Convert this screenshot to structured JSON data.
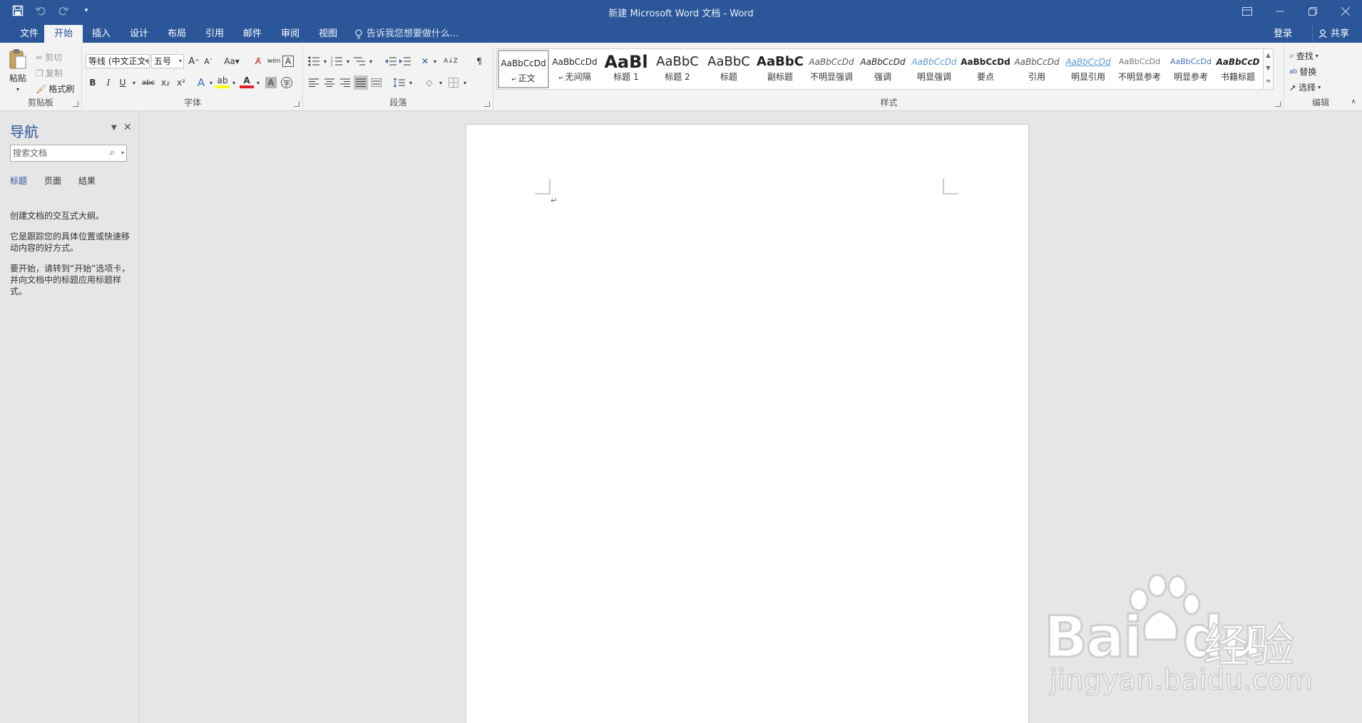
{
  "window": {
    "title": "新建 Microsoft Word 文档 - Word",
    "controls": [
      "restore-ribbon",
      "minimize",
      "maximize",
      "close"
    ]
  },
  "qat": {
    "icons": [
      "save-icon",
      "undo-icon",
      "redo-icon",
      "customize-icon"
    ]
  },
  "tabs": {
    "file": "文件",
    "home": "开始",
    "insert": "插入",
    "design": "设计",
    "layout": "布局",
    "references": "引用",
    "mailings": "邮件",
    "review": "审阅",
    "view": "视图"
  },
  "tellme": "告诉我您想要做什么...",
  "account": {
    "login": "登录",
    "share": "共享"
  },
  "clipboard": {
    "paste": "粘贴",
    "cut": "剪切",
    "copy": "复制",
    "format_painter": "格式刷",
    "label": "剪贴板"
  },
  "font": {
    "name": "等线 (中文正文)",
    "size": "五号",
    "case": "Aa",
    "label": "字体",
    "buttons": [
      "B",
      "I",
      "U",
      "abc",
      "x₂",
      "x²"
    ]
  },
  "paragraph": {
    "label": "段落"
  },
  "styles": {
    "label": "样式",
    "items": [
      {
        "sample": "AaBbCcDd",
        "name": "正文"
      },
      {
        "sample": "AaBbCcDd",
        "name": "无间隔"
      },
      {
        "sample": "AaBl",
        "name": "标题 1"
      },
      {
        "sample": "AaBbC",
        "name": "标题 2"
      },
      {
        "sample": "AaBbC",
        "name": "标题"
      },
      {
        "sample": "AaBbC",
        "name": "副标题"
      },
      {
        "sample": "AaBbCcDd",
        "name": "不明显强调"
      },
      {
        "sample": "AaBbCcDd",
        "name": "强调"
      },
      {
        "sample": "AaBbCcDd",
        "name": "明显强调"
      },
      {
        "sample": "AaBbCcDd",
        "name": "要点"
      },
      {
        "sample": "AaBbCcDd",
        "name": "引用"
      },
      {
        "sample": "AaBbCcDd",
        "name": "明显引用"
      },
      {
        "sample": "AaBbCcDd",
        "name": "不明显参考"
      },
      {
        "sample": "AaBbCcDd",
        "name": "明显参考"
      },
      {
        "sample": "AaBbCcD",
        "name": "书籍标题"
      }
    ]
  },
  "editing": {
    "find": "查找",
    "replace": "替换",
    "select": "选择",
    "label": "编辑"
  },
  "nav": {
    "title": "导航",
    "search_placeholder": "搜索文档",
    "tabs": {
      "headings": "标题",
      "pages": "页面",
      "results": "结果"
    },
    "p1": "创建文档的交互式大纲。",
    "p2": "它是跟踪您的具体位置或快速移动内容的好方式。",
    "p3": "要开始，请转到“开始”选项卡，并向文档中的标题应用标题样式。"
  },
  "document": {
    "paragraph_mark": "↵"
  },
  "watermark": {
    "brand": "Bai",
    "brand2": "du",
    "cn": "经验",
    "url": "jingyan.baidu.com"
  },
  "colors": {
    "accent": "#2b579a",
    "ribbon_bg": "#f3f3f3",
    "workspace_bg": "#e6e6e6"
  }
}
